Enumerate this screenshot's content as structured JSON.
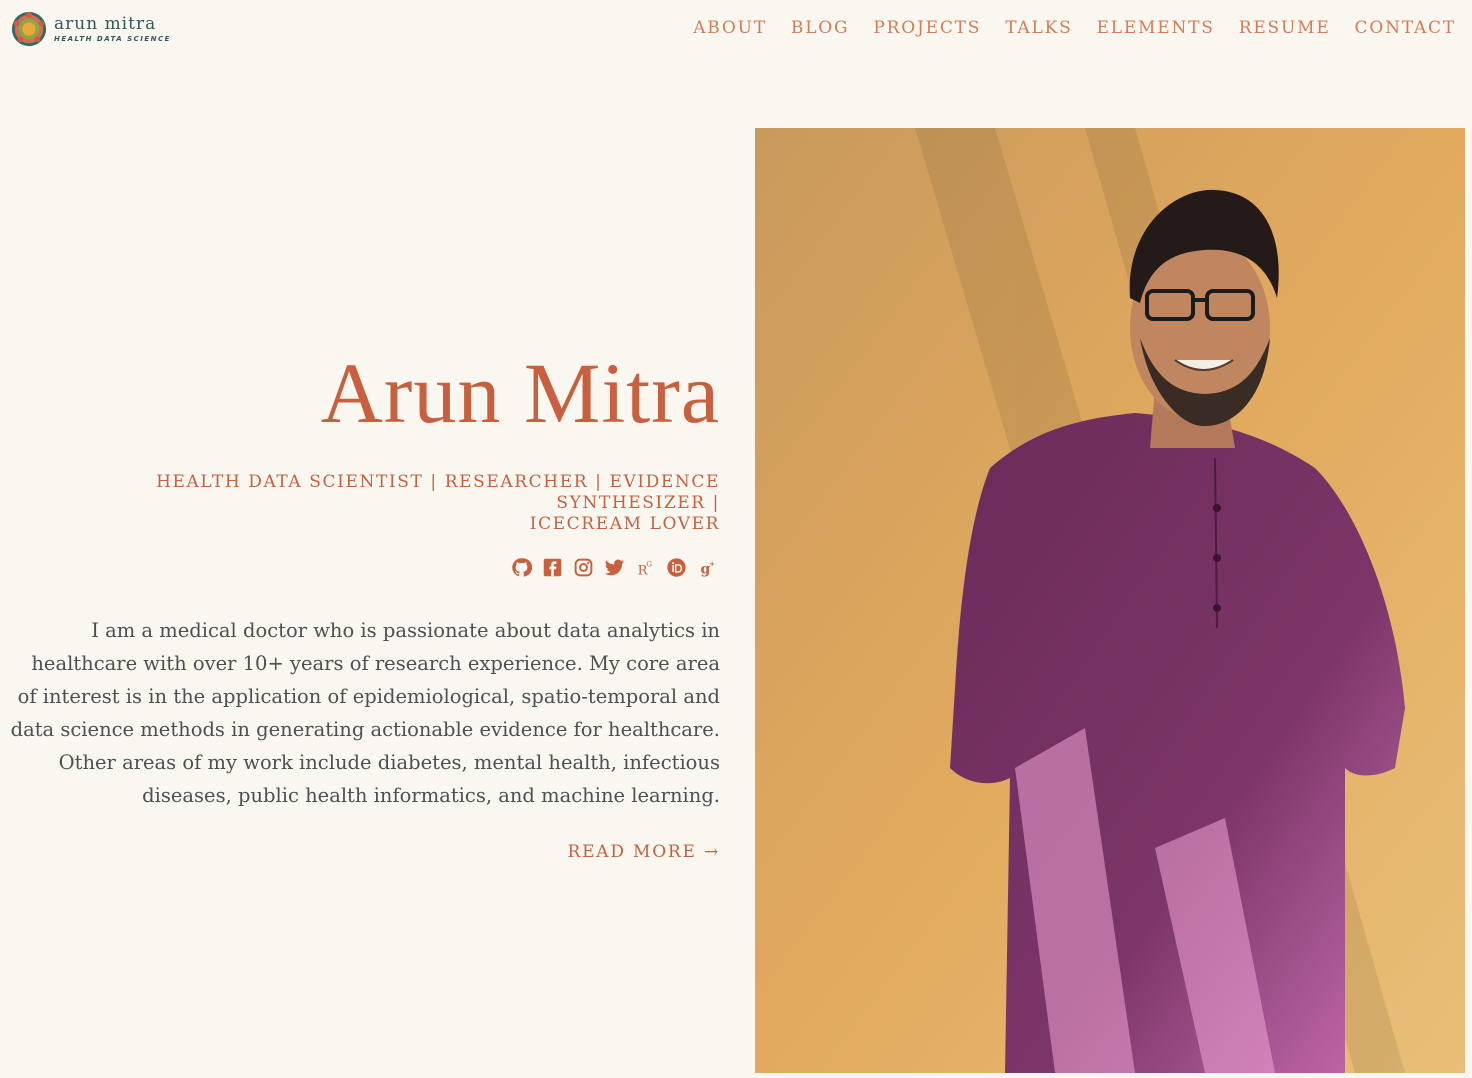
{
  "brand": {
    "name": "arun  mitra",
    "tagline": "HEALTH DATA SCIENCE"
  },
  "nav": [
    "ABOUT",
    "BLOG",
    "PROJECTS",
    "TALKS",
    "ELEMENTS",
    "RESUME",
    "CONTACT"
  ],
  "hero": {
    "name": "Arun Mitra",
    "roles_line1": "HEALTH DATA SCIENTIST | RESEARCHER | EVIDENCE SYNTHESIZER |",
    "roles_line2": "ICECREAM LOVER",
    "bio": "I am a medical doctor who is passionate about data analytics in healthcare with over 10+ years of research experience. My core area of interest is in the application of epidemiological, spatio-temporal and data science methods in generating actionable evidence for healthcare. Other areas of my work include diabetes, mental health, infectious diseases, public health informatics, and machine learning.",
    "read_more": "READ MORE →"
  },
  "socials": [
    "github-icon",
    "facebook-icon",
    "instagram-icon",
    "twitter-icon",
    "researchgate-icon",
    "orcid-icon",
    "google-scholar-icon"
  ],
  "colors": {
    "background": "#f9f7ef",
    "accent": "#c8603f",
    "nav": "#d77a55",
    "brand": "#2f5a5a"
  }
}
